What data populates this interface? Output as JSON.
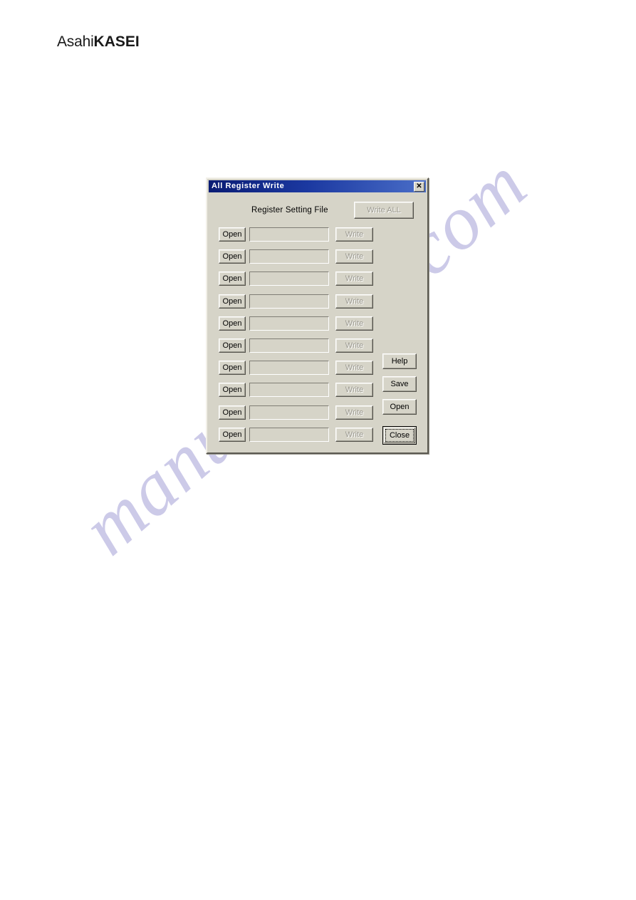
{
  "page": {
    "logo": {
      "part_light": "Asahi",
      "part_bold": "KASEI"
    },
    "watermark": "manualshive.com",
    "background_color": "#ffffff"
  },
  "dialog": {
    "title": "All Register Write",
    "titlebar_close_glyph": "✕",
    "background_color": "#d6d4c8",
    "titlebar_color": "#0a1c74",
    "header_label": "Register Setting File",
    "write_all_button": {
      "label": "Write ALL",
      "enabled": false
    },
    "rows": [
      {
        "open_label": "Open",
        "value": "",
        "placeholder": "",
        "write_label": "Write",
        "write_enabled": false
      },
      {
        "open_label": "Open",
        "value": "",
        "placeholder": "",
        "write_label": "Write",
        "write_enabled": false
      },
      {
        "open_label": "Open",
        "value": "",
        "placeholder": "",
        "write_label": "Write",
        "write_enabled": false
      },
      {
        "open_label": "Open",
        "value": "",
        "placeholder": "",
        "write_label": "Write",
        "write_enabled": false
      },
      {
        "open_label": "Open",
        "value": "",
        "placeholder": "",
        "write_label": "Write",
        "write_enabled": false
      },
      {
        "open_label": "Open",
        "value": "",
        "placeholder": "",
        "write_label": "Write",
        "write_enabled": false
      },
      {
        "open_label": "Open",
        "value": "",
        "placeholder": "",
        "write_label": "Write",
        "write_enabled": false
      },
      {
        "open_label": "Open",
        "value": "",
        "placeholder": "",
        "write_label": "Write",
        "write_enabled": false
      },
      {
        "open_label": "Open",
        "value": "",
        "placeholder": "",
        "write_label": "Write",
        "write_enabled": false
      },
      {
        "open_label": "Open",
        "value": "",
        "placeholder": "",
        "write_label": "Write",
        "write_enabled": false
      }
    ],
    "side_buttons": [
      {
        "label": "Help",
        "enabled": true,
        "default": false
      },
      {
        "label": "Save",
        "enabled": true,
        "default": false
      },
      {
        "label": "Open",
        "enabled": true,
        "default": false
      },
      {
        "label": "Close",
        "enabled": true,
        "default": true
      }
    ]
  }
}
